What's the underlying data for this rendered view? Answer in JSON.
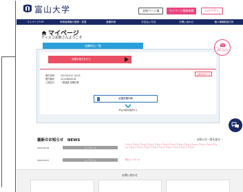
{
  "header": {
    "logo_text": "富山大学",
    "site_button": "全体ページ ⧉",
    "apply_button": "マイページ登録申請",
    "logout_button": "ログアウト"
  },
  "nav": {
    "items": [
      "マイページTOP",
      "申請者情報の登録・変更",
      "各種申請",
      "お支払い方法",
      "お問い合わせ",
      "個人情報取扱方針"
    ]
  },
  "page": {
    "title": "マイページ",
    "welcome": "ディスコ太郎さんようこそ"
  },
  "tab": {
    "label": "出願申込一覧"
  },
  "inquiry": {
    "label": "マイページ\nお問い合わせ"
  },
  "cta": {
    "label": "出願手続きを行う"
  },
  "application": {
    "status": "出願登録完了済",
    "rows": [
      {
        "label": "受付日時：",
        "value": "2021/03/10 16:43"
      },
      {
        "label": "受付番号：",
        "value": "2210460001B"
      },
      {
        "label": "入試区分：",
        "value": "一般選抜 前期日程"
      }
    ],
    "pdf_button": "出願書類印刷",
    "expand_label": "申込内容を確認する"
  },
  "news": {
    "title": "最新のお知らせ　NEWS",
    "more": "お知らせ一覧を見る ›",
    "items": [
      {
        "date": "2021/03/18",
        "category": "メンテナンス",
        "body": "テキストテキストテキストテキストテキストテキストテキストテキストテキストテキストテキストテキストテキストテキストテキストテキストテキストテキストテキストテキストテキストテキスト"
      },
      {
        "date": "2021/03/17",
        "category": "メンテナンス",
        "body": "緊急メンテナンス"
      }
    ]
  },
  "footer": {
    "title": "お問い合わせ"
  },
  "colors": {
    "navy": "#1a2a66",
    "pink": "#e8457f",
    "red": "#e94e63",
    "blue": "#2b9fd9"
  }
}
